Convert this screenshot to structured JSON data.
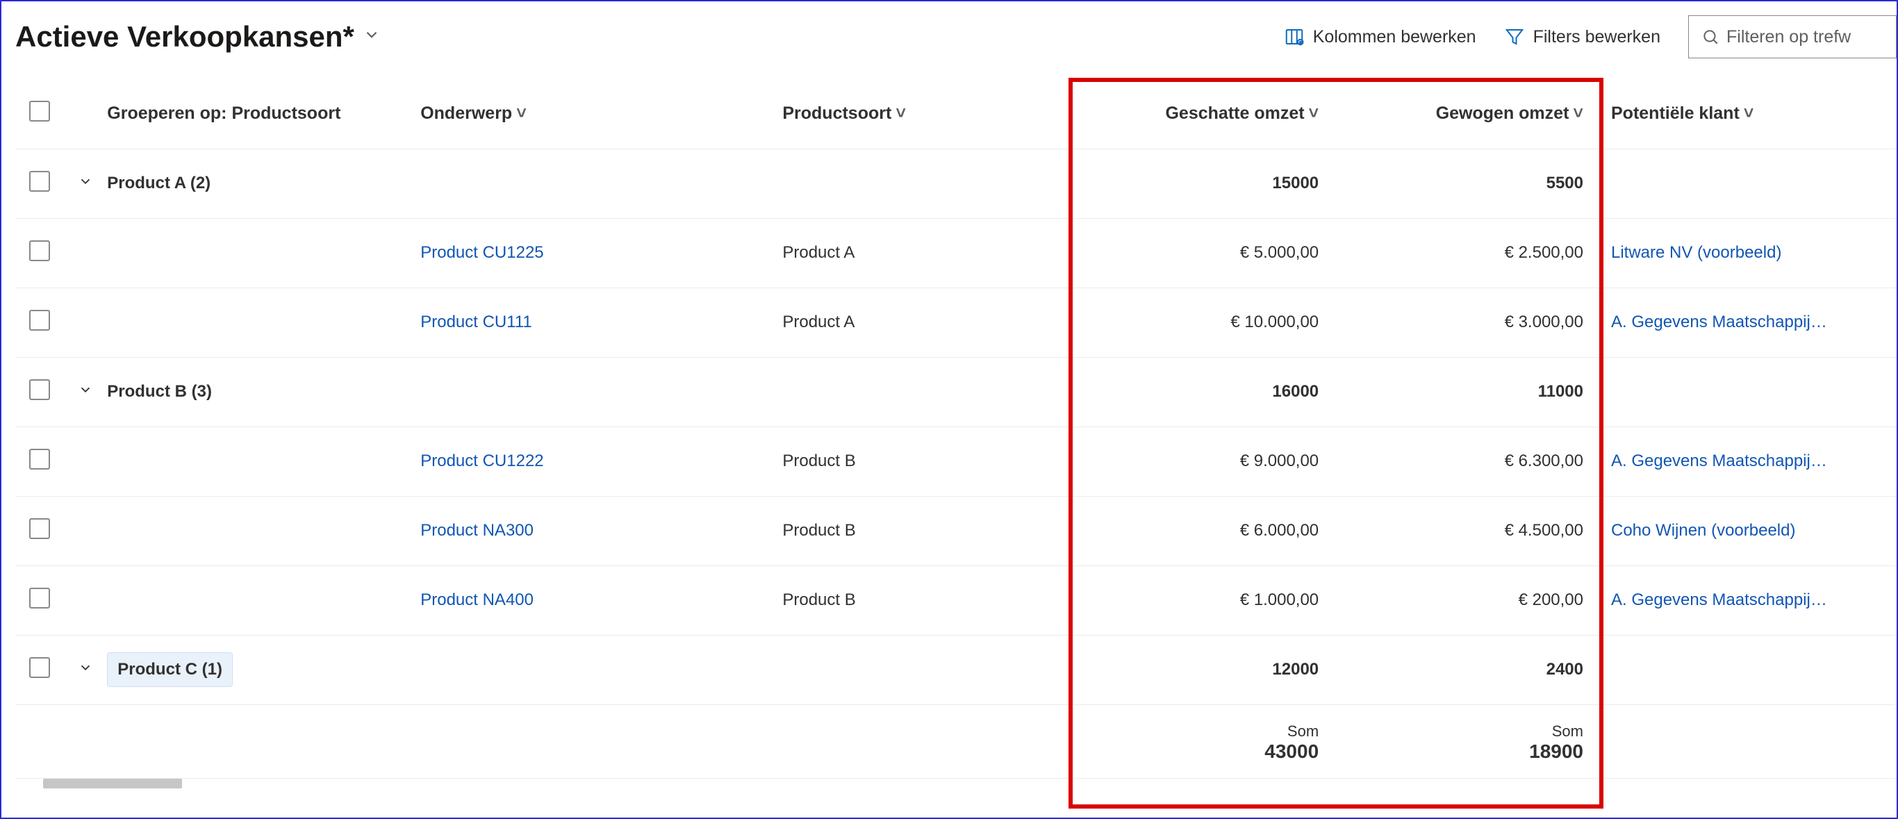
{
  "header": {
    "title": "Actieve Verkoopkansen*",
    "edit_columns": "Kolommen bewerken",
    "edit_filters": "Filters bewerken",
    "search_placeholder": "Filteren op trefw"
  },
  "columns": {
    "group_by": "Groeperen op: Productsoort",
    "subject": "Onderwerp",
    "type": "Productsoort",
    "est": "Geschatte omzet",
    "weighted": "Gewogen omzet",
    "client": "Potentiële klant"
  },
  "groups": [
    {
      "label": "Product A (2)",
      "est_sum": "15000",
      "weighted_sum": "5500",
      "active": false,
      "rows": [
        {
          "subject": "Product CU1225",
          "type": "Product A",
          "est": "€ 5.000,00",
          "weighted": "€ 2.500,00",
          "client": "Litware NV (voorbeeld)"
        },
        {
          "subject": "Product CU111",
          "type": "Product A",
          "est": "€ 10.000,00",
          "weighted": "€ 3.000,00",
          "client": "A. Gegevens Maatschappij…"
        }
      ]
    },
    {
      "label": "Product B (3)",
      "est_sum": "16000",
      "weighted_sum": "11000",
      "active": false,
      "rows": [
        {
          "subject": "Product CU1222",
          "type": "Product B",
          "est": "€ 9.000,00",
          "weighted": "€ 6.300,00",
          "client": "A. Gegevens Maatschappij…"
        },
        {
          "subject": "Product NA300",
          "type": "Product B",
          "est": "€ 6.000,00",
          "weighted": "€ 4.500,00",
          "client": "Coho Wijnen (voorbeeld)"
        },
        {
          "subject": "Product NA400",
          "type": "Product B",
          "est": "€ 1.000,00",
          "weighted": "€ 200,00",
          "client": "A. Gegevens Maatschappij…"
        }
      ]
    },
    {
      "label": "Product C (1)",
      "est_sum": "12000",
      "weighted_sum": "2400",
      "active": true,
      "rows": []
    }
  ],
  "footer": {
    "label": "Som",
    "est_total": "43000",
    "weighted_total": "18900"
  }
}
